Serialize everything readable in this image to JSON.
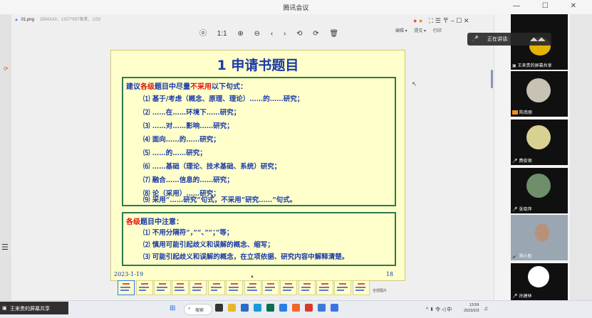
{
  "app": {
    "title": "腾讯会议",
    "window_controls": "— ☐ ✕"
  },
  "file": {
    "name": "01.png",
    "info": "1954X43，1337*997像素，1/33"
  },
  "viewer_toolbar": [
    "ⓞ",
    "1:1",
    "⊕",
    "⊖",
    "‹",
    "›",
    "⟲",
    "⟳",
    "🗑"
  ],
  "viewer_right": [
    "编辑 ▾",
    "提交 ▾",
    "打印"
  ],
  "slide": {
    "title": "1  申请书题目",
    "box1_head_parts": [
      "建议",
      "各级",
      "题目中尽量",
      "不采用",
      "以下句式："
    ],
    "items": [
      "⑴ 基于/考虑（概念、原理、理论）……的……研究；",
      "⑵ ……在……环境下……研究；",
      "⑶ ……对……影响……研究；",
      "⑷ 面向……的……研究；",
      "⑸ ……的……研究；",
      "⑹ ……基础（理论、技术基础、系统）研究；",
      "⑺ 融合……信息的……研究；",
      "⑻ 论（采用）……研究；",
      "⑼ 采用“……研究”句式，不采用“研究……”句式。"
    ],
    "box2_head_parts": [
      "各级",
      "题目中注意："
    ],
    "notes": [
      "⑴ 不用分隔符“，”“、”“；”等；",
      "⑵ 慎用可能引起歧义和误解的概念、缩写；",
      "⑶ 可能引起歧义和误解的概念，在立项依据、研究内容中解释清楚。"
    ],
    "date": "2023-1-19",
    "page": "18"
  },
  "thumbnails_label": "全部图片",
  "speaking": {
    "label": "正在讲话:"
  },
  "participants": [
    {
      "name": "王来贵的屏幕共享",
      "avatar": "yellow-badge"
    },
    {
      "name": "陈南丽",
      "avatar": "cat-photo"
    },
    {
      "name": "费俊钢",
      "avatar": "yellow-circle"
    },
    {
      "name": "张晓萍",
      "avatar": "landscape"
    },
    {
      "name": "郑小彪",
      "avatar": "camera-video"
    },
    {
      "name": "孙建林",
      "avatar": "cartoon-bee"
    }
  ],
  "taskbar": {
    "share_label": "王来贵的屏幕共享",
    "search_label": "搜索",
    "tray": "^ ⬇ 令 ◁ 中",
    "time": "13:59",
    "date": "2023/2/3"
  },
  "colors": {
    "slide_bg": "#ffffcc",
    "slide_blue": "#1a3aa8",
    "slide_red": "#e0140f",
    "box_border": "#2b7a4b"
  }
}
